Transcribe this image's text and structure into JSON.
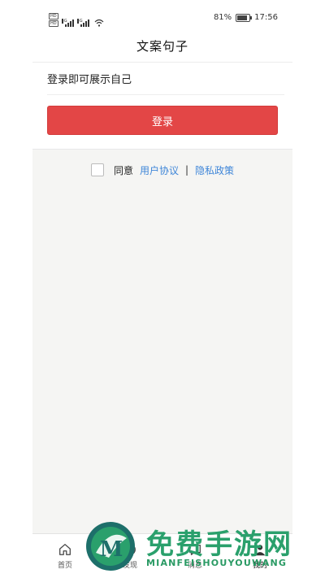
{
  "status_bar": {
    "sim1": "HD",
    "sim2": "HD",
    "network1": "4G",
    "network2": "4G",
    "battery_percent": "81%",
    "battery_level": 0.81,
    "time": "17:56"
  },
  "header": {
    "title": "文案句子"
  },
  "login": {
    "prompt": "登录即可展示自己",
    "button_label": "登录"
  },
  "agreement": {
    "agree_label": "同意",
    "user_agreement_link": "用户协议",
    "separator": "|",
    "privacy_policy_link": "隐私政策"
  },
  "tab_bar": {
    "tabs": [
      {
        "label": "首页",
        "icon": "home-icon"
      },
      {
        "label": "发现",
        "icon": "discover-icon"
      },
      {
        "label": "消息",
        "icon": "message-icon"
      },
      {
        "label": "我的",
        "icon": "profile-icon"
      }
    ]
  },
  "watermark": {
    "title": "免费手游网",
    "subtitle": "MIANFEISHOUYOUWANG",
    "logo_letter": "M"
  },
  "colors": {
    "primary_button": "#e34646",
    "link": "#3f86d8",
    "watermark_green": "#2aa06c"
  }
}
